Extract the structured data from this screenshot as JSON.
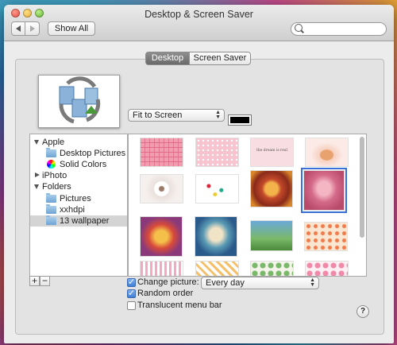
{
  "window": {
    "title": "Desktop & Screen Saver"
  },
  "toolbar": {
    "show_all_label": "Show All",
    "search_placeholder": ""
  },
  "tabs": [
    {
      "label": "Desktop",
      "selected": true
    },
    {
      "label": "Screen Saver",
      "selected": false
    }
  ],
  "fit_popup": {
    "value": "Fit to Screen"
  },
  "background_color": "#000000",
  "source_list": {
    "items": [
      {
        "label": "Apple",
        "type": "group"
      },
      {
        "label": "Desktop Pictures",
        "type": "folder"
      },
      {
        "label": "Solid Colors",
        "type": "colors"
      },
      {
        "label": "iPhoto",
        "type": "group-collapsed"
      },
      {
        "label": "Folders",
        "type": "group"
      },
      {
        "label": "Pictures",
        "type": "folder"
      },
      {
        "label": "xxhdpi",
        "type": "folder"
      },
      {
        "label": "13 wallpaper",
        "type": "folder",
        "selected": true
      }
    ]
  },
  "thumbnails": [
    {
      "title": "",
      "selected": false,
      "caption": ""
    },
    {
      "title": "",
      "selected": false,
      "caption": ""
    },
    {
      "title": "",
      "selected": false,
      "caption": "the dream is real"
    },
    {
      "title": "",
      "selected": false,
      "caption": ""
    },
    {
      "title": "",
      "selected": false,
      "caption": ""
    },
    {
      "title": "",
      "selected": false,
      "caption": ""
    },
    {
      "title": "",
      "selected": false,
      "caption": ""
    },
    {
      "title": "",
      "selected": true,
      "caption": ""
    },
    {
      "title": "",
      "selected": false,
      "caption": ""
    },
    {
      "title": "",
      "selected": false,
      "caption": ""
    },
    {
      "title": "",
      "selected": false,
      "caption": ""
    },
    {
      "title": "",
      "selected": false,
      "caption": ""
    },
    {
      "title": "",
      "selected": false,
      "caption": ""
    },
    {
      "title": "",
      "selected": false,
      "caption": ""
    },
    {
      "title": "",
      "selected": false,
      "caption": ""
    },
    {
      "title": "",
      "selected": false,
      "caption": ""
    }
  ],
  "list_buttons": {
    "add": "+",
    "remove": "−"
  },
  "options": {
    "change_picture": {
      "label": "Change picture:",
      "checked": true,
      "interval": "Every day"
    },
    "random_order": {
      "label": "Random order",
      "checked": true
    },
    "translucent_menu_bar": {
      "label": "Translucent menu bar",
      "checked": false
    }
  },
  "help_label": "?"
}
